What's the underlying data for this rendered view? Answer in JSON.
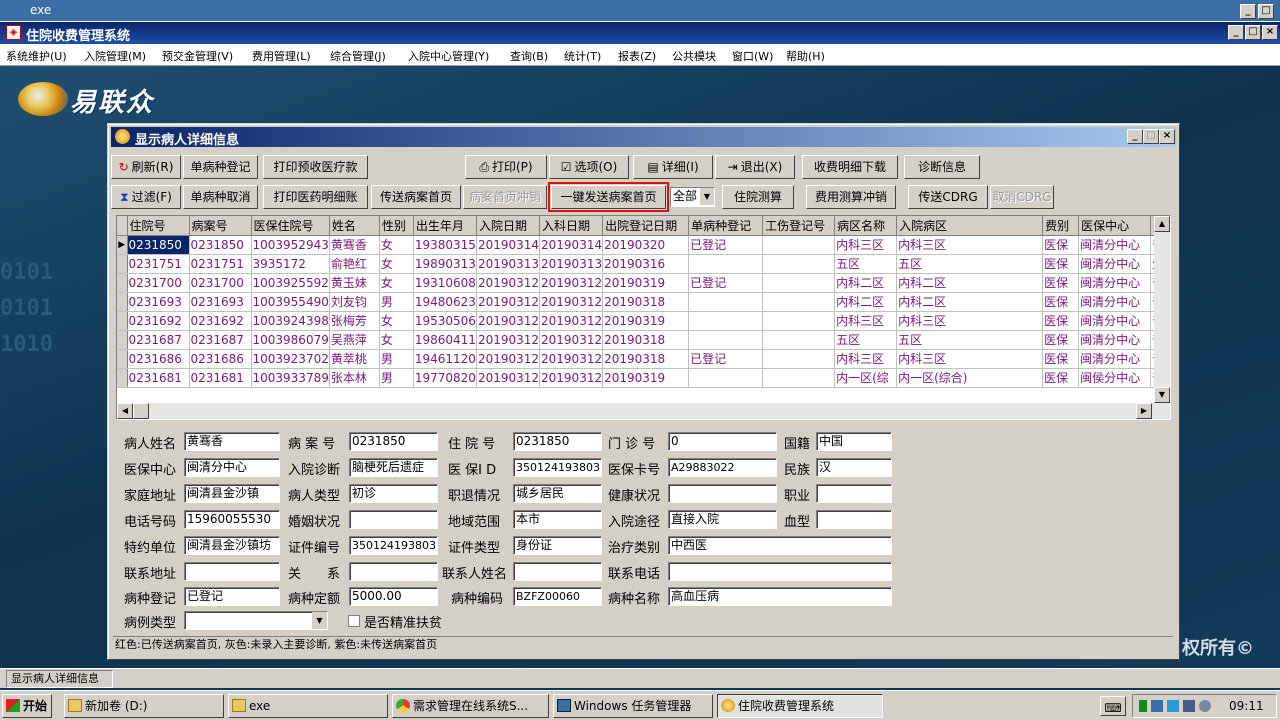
{
  "outer_window": {
    "title": "exe"
  },
  "app": {
    "title": "住院收费管理系统",
    "menu": [
      "系统维护(U)",
      "入院管理(M)",
      "预交金管理(V)",
      "费用管理(L)",
      "综合管理(J)",
      "入院中心管理(Y)",
      "查询(B)",
      "统计(T)",
      "报表(Z)",
      "公共模块",
      "窗口(W)",
      "帮助(H)"
    ]
  },
  "logo": {
    "text": "易联众"
  },
  "copyright": "权所有©",
  "dialog": {
    "title": "显示病人详细信息",
    "toolbar_row1": {
      "refresh": "刷新(R)",
      "single_disease_register": "单病种登记",
      "print_prepay": "打印预收医疗款",
      "print": "打印(P)",
      "options": "选项(O)",
      "detail": "详细(I)",
      "exit": "退出(X)",
      "fee_detail_download": "收费明细下载",
      "diagnosis_info": "诊断信息"
    },
    "toolbar_row2": {
      "filter": "过滤(F)",
      "single_disease_cancel": "单病种取消",
      "print_drug_detail": "打印医药明细账",
      "send_case_home": "传送病案首页",
      "case_home_reverse": "病案首页冲销",
      "one_click_send": "一键发送病案首页",
      "scope_select": "全部",
      "inpatient_calc": "住院测算",
      "fee_calc_reverse": "费用测算冲销",
      "send_cdrg": "传送CDRG",
      "cancel_cdrg": "取消CDRG"
    }
  },
  "grid": {
    "columns": [
      "住院号",
      "病案号",
      "医保住院号",
      "姓名",
      "性别",
      "出生年月",
      "入院日期",
      "入科日期",
      "出院登记日期",
      "单病种登记",
      "工伤登记号",
      "病区名称",
      "入院病区",
      "费别",
      "医保中心",
      "入"
    ],
    "rows": [
      [
        "0231850",
        "0231850",
        "1003952943",
        "黄骞香",
        "女",
        "19380315",
        "20190314",
        "20190314",
        "20190320",
        "已登记",
        "",
        "内科三区",
        "内科三区",
        "医保",
        "闽清分中心",
        "普"
      ],
      [
        "0231751",
        "0231751",
        "3935172",
        "俞艳红",
        "女",
        "19890313",
        "20190313",
        "20190313",
        "20190316",
        "",
        "",
        "五区",
        "五区",
        "医保",
        "闽清分中心",
        "生"
      ],
      [
        "0231700",
        "0231700",
        "1003925592",
        "黄玉妹",
        "女",
        "19310608",
        "20190312",
        "20190312",
        "20190319",
        "已登记",
        "",
        "内科二区",
        "内科二区",
        "医保",
        "闽清分中心",
        "普"
      ],
      [
        "0231693",
        "0231693",
        "1003955490",
        "刘友钧",
        "男",
        "19480623",
        "20190312",
        "20190312",
        "20190318",
        "",
        "",
        "内科二区",
        "内科二区",
        "医保",
        "闽清分中心",
        "普"
      ],
      [
        "0231692",
        "0231692",
        "1003924398",
        "张梅芳",
        "女",
        "19530506",
        "20190312",
        "20190312",
        "20190319",
        "",
        "",
        "内科三区",
        "内科三区",
        "医保",
        "闽清分中心",
        "普"
      ],
      [
        "0231687",
        "0231687",
        "1003986079",
        "吴燕萍",
        "女",
        "19860411",
        "20190312",
        "20190312",
        "20190318",
        "",
        "",
        "五区",
        "五区",
        "医保",
        "闽清分中心",
        "普"
      ],
      [
        "0231686",
        "0231686",
        "1003923702",
        "黄萃桃",
        "男",
        "19461120",
        "20190312",
        "20190312",
        "20190318",
        "已登记",
        "",
        "内科三区",
        "内科三区",
        "医保",
        "闽清分中心",
        "普"
      ],
      [
        "0231681",
        "0231681",
        "1003933789",
        "张本林",
        "男",
        "19770820",
        "20190312",
        "20190312",
        "20190319",
        "",
        "",
        "内一区(综",
        "内一区(综合)",
        "医保",
        "闽侯分中心",
        "普"
      ]
    ]
  },
  "form": {
    "labels": {
      "name": "病人姓名",
      "case_no": "病 案 号",
      "inpatient_no": "住 院 号",
      "outpatient_no": "门 诊 号",
      "nationality": "国籍",
      "insurance_center": "医保中心",
      "admit_diag": "入院诊断",
      "insurance_id": "医 保I D",
      "insurance_card": "医保卡号",
      "ethnicity": "民族",
      "address": "家庭地址",
      "patient_type": "病人类型",
      "employment": "职退情况",
      "health": "健康状况",
      "occupation": "职业",
      "phone": "电话号码",
      "marital": "婚姻状况",
      "region": "地域范围",
      "admit_route": "入院途径",
      "blood": "血型",
      "contract_unit": "特约单位",
      "cert_no": "证件编号",
      "cert_type": "证件类型",
      "treatment_type": "治疗类别",
      "contact_addr": "联系地址",
      "relation": "关　　系",
      "contact_name": "联系人姓名",
      "contact_phone": "联系电话",
      "disease_register": "病种登记",
      "disease_quota": "病种定额",
      "disease_code": "病种编码",
      "disease_name": "病种名称",
      "case_type": "病例类型",
      "poverty": "是否精准扶贫"
    },
    "values": {
      "name": "黄骞香",
      "case_no": "0231850",
      "inpatient_no": "0231850",
      "outpatient_no": "0",
      "nationality": "中国",
      "insurance_center": "闽清分中心",
      "admit_diag": "脑梗死后遗症",
      "insurance_id": "350124193803",
      "insurance_card": "A29883022",
      "ethnicity": "汉",
      "address": "闽清县金沙镇",
      "patient_type": "初诊",
      "employment": "城乡居民",
      "health": "",
      "occupation": "",
      "phone": "15960055530",
      "marital": "",
      "region": "本市",
      "admit_route": "直接入院",
      "blood": "",
      "contract_unit": "闽清县金沙镇坊",
      "cert_no": "350124193803",
      "cert_type": "身份证",
      "treatment_type": "中西医",
      "contact_addr": "",
      "relation": "",
      "contact_name": "",
      "contact_phone": "",
      "disease_register": "已登记",
      "disease_quota": "5000.00",
      "disease_code": "BZFZ00060",
      "disease_name": "高血压病",
      "case_type": ""
    }
  },
  "status_legend": "红色:已传送病案首页, 灰色:未录入主要诊断, 紫色:未传送病案首页",
  "mdi_tab": "显示病人详细信息",
  "taskbar": {
    "start": "开始",
    "items": [
      "新加卷 (D:)",
      "exe",
      "需求管理在线系统S...",
      "Windows 任务管理器",
      "住院收费管理系统"
    ],
    "clock": "09:11"
  }
}
